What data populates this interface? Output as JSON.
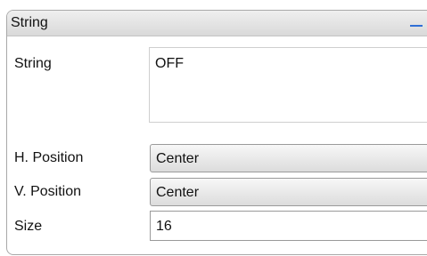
{
  "panel": {
    "title": "String",
    "collapse_icon": "minus-icon"
  },
  "fields": {
    "string": {
      "label": "String",
      "value": "OFF"
    },
    "h_position": {
      "label": "H. Position",
      "value": "Center"
    },
    "v_position": {
      "label": "V. Position",
      "value": "Center"
    },
    "size": {
      "label": "Size",
      "value": "16"
    }
  },
  "colors": {
    "accent": "#2f6fd6",
    "header_bg": "#e4e4e4",
    "border": "#a9a9a9"
  }
}
